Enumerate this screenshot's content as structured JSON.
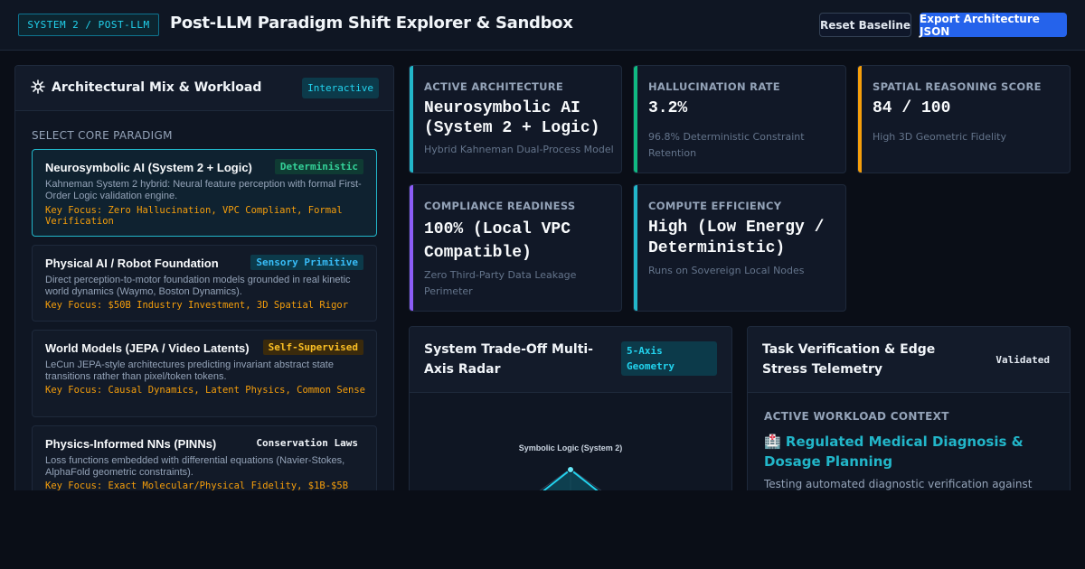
{
  "header": {
    "system_tag": "SYSTEM 2 / POST-LLM",
    "title": "Post-LLM Paradigm Shift Explorer & Sandbox",
    "reset_label": "Reset Baseline",
    "export_label": "Export Architecture JSON"
  },
  "left_panel": {
    "icon": "sparkle-icon",
    "title": "Architectural Mix & Workload",
    "badge": "Interactive",
    "section_label": "SELECT CORE PARADIGM",
    "paradigms": [
      {
        "name": "Neurosymbolic AI (System 2 + Logic)",
        "badge": "Deterministic",
        "description": "Kahneman System 2 hybrid: Neural feature perception with formal First-Order Logic validation engine.",
        "focus": "Key Focus: Zero Hallucination, VPC Compliant, Formal Verification",
        "active": true,
        "badge_bg": "#0f3b33",
        "badge_fg": "#34d399"
      },
      {
        "name": "Physical AI / Robot Foundation",
        "badge": "Sensory Primitive",
        "description": "Direct perception-to-motor foundation models grounded in real kinetic world dynamics (Waymo, Boston Dynamics).",
        "focus": "Key Focus: $50B Industry Investment, 3D Spatial Rigor",
        "active": false,
        "badge_bg": "#0c3a4a",
        "badge_fg": "#38bdf8"
      },
      {
        "name": "World Models (JEPA / Video Latents)",
        "badge": "Self-Supervised",
        "description": "LeCun JEPA-style architectures predicting invariant abstract state transitions rather than pixel/token tokens.",
        "focus": "Key Focus: Causal Dynamics, Latent Physics, Common Sense",
        "active": false,
        "badge_bg": "#3a2a0c",
        "badge_fg": "#fbbf24"
      },
      {
        "name": "Physics-Informed NNs (PINNs)",
        "badge": "Conservation Laws",
        "description": "Loss functions embedded with differential equations (Navier-Stokes, AlphaFold geometric constraints).",
        "focus": "Key Focus: Exact Molecular/Physical Fidelity, $1B-$5B",
        "active": false,
        "badge_bg": "#121a28",
        "badge_fg": "#f1f5f9"
      }
    ]
  },
  "metrics": [
    {
      "label": "ACTIVE ARCHITECTURE",
      "value": "Neurosymbolic AI (System 2 + Logic)",
      "sub": "Hybrid Kahneman Dual-Process Model",
      "accent": "#22b6c9"
    },
    {
      "label": "HALLUCINATION RATE",
      "value": "3.2%",
      "sub": "96.8% Deterministic Constraint Retention",
      "accent": "#10b981"
    },
    {
      "label": "SPATIAL REASONING SCORE",
      "value": "84 / 100",
      "sub": "High 3D Geometric Fidelity",
      "accent": "#f59e0b"
    },
    {
      "label": "COMPLIANCE READINESS",
      "value": "100% (Local VPC Compatible)",
      "sub": "Zero Third-Party Data Leakage Perimeter",
      "accent": "#8b5cf6"
    },
    {
      "label": "COMPUTE EFFICIENCY",
      "value": "High (Low Energy / Deterministic)",
      "sub": "Runs on Sovereign Local Nodes",
      "accent": "#22b6c9"
    }
  ],
  "radar": {
    "title": "System Trade-Off Multi-Axis Radar",
    "badge": "5-Axis Geometry",
    "axis_label_top": "Symbolic Logic (System 2)"
  },
  "telemetry": {
    "title": "Task Verification & Edge Stress Telemetry",
    "badge": "Validated",
    "context_label": "ACTIVE WORKLOAD CONTEXT",
    "workload_icon": "hospital-icon",
    "workload_emoji": "🏥",
    "workload": "Regulated Medical Diagnosis & Dosage Planning",
    "description": "Testing automated diagnostic verification against"
  }
}
